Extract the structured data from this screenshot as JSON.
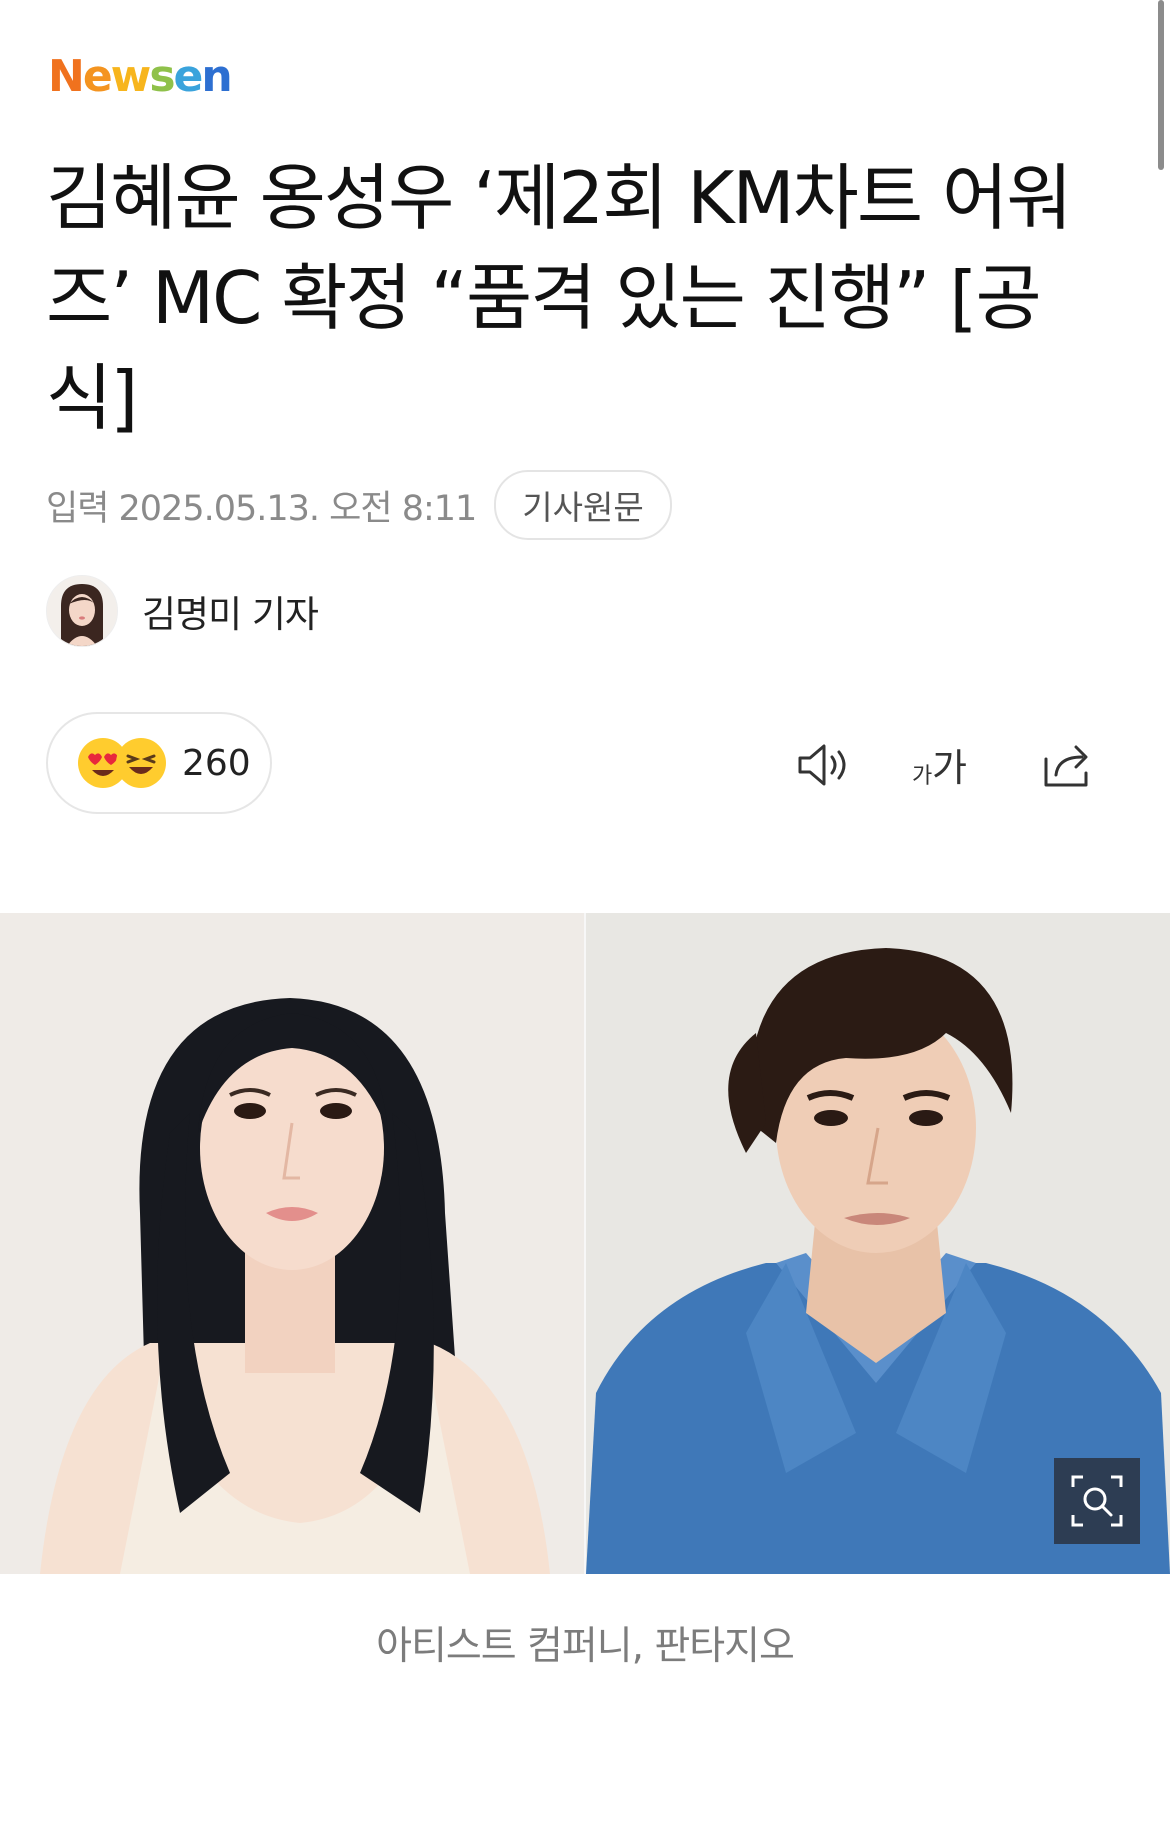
{
  "brand": {
    "logo_text": "Newsen",
    "logo_letters": [
      "N",
      "e",
      "w",
      "s",
      "e",
      "n"
    ],
    "logo_colors": [
      "#f0721e",
      "#f49420",
      "#f7b51d",
      "#8fc14a",
      "#3aa3dc",
      "#2d6fd1"
    ]
  },
  "article": {
    "headline": "김혜윤 옹성우 ‘제2회 KM차트 어워즈’ MC 확정 “품격 있는 진행” [공식]",
    "published": "입력 2025.05.13. 오전 8:11",
    "source_button": "기사원문",
    "author": "김명미 기자"
  },
  "reactions": {
    "count": "260",
    "emojis": [
      "heart-eyes-emoji",
      "laughing-emoji"
    ]
  },
  "toolbar": {
    "icons": [
      "speaker-icon",
      "font-size-icon",
      "share-icon"
    ],
    "font_small": "가",
    "font_large": "가"
  },
  "photo": {
    "caption": "아티스트 컴퍼니, 판타지오",
    "zoom_icon": "zoom-search-icon"
  },
  "colors": {
    "text_primary": "#111111",
    "text_muted": "#8a8a8a",
    "pill_border": "#e4e4e4",
    "emoji_yellow": "#ffcc2e"
  }
}
